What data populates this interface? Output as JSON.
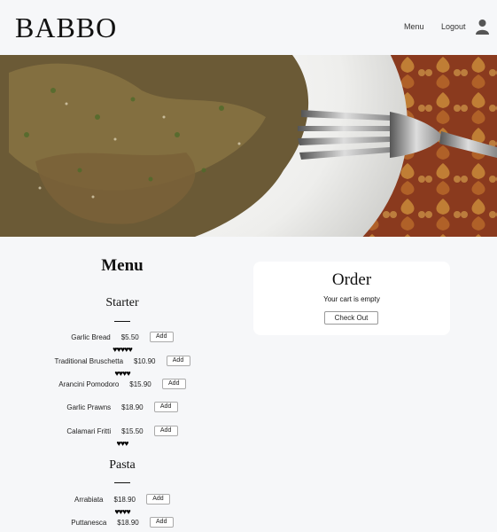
{
  "header": {
    "logo": "BABBO",
    "nav": {
      "menu": "Menu",
      "logout": "Logout"
    },
    "user_icon": "user-icon"
  },
  "hero": {
    "image": "pasta-plate-with-fork"
  },
  "menu": {
    "title": "Menu",
    "add_label": "Add",
    "sections": [
      {
        "title": "Starter",
        "items": [
          {
            "name": "Garlic Bread",
            "price": "$5.50",
            "hearts": "♥♥♥♥♥"
          },
          {
            "name": "Traditional Bruschetta",
            "price": "$10.90",
            "hearts": "♥♥♥♥"
          },
          {
            "name": "Arancini Pomodoro",
            "price": "$15.90",
            "hearts": ""
          },
          {
            "name": "Garlic Prawns",
            "price": "$18.90",
            "hearts": ""
          },
          {
            "name": "Calamari Fritti",
            "price": "$15.50",
            "hearts": "♥♥♥"
          }
        ]
      },
      {
        "title": "Pasta",
        "items": [
          {
            "name": "Arrabiata",
            "price": "$18.90",
            "hearts": "♥♥♥♥"
          },
          {
            "name": "Puttanesca",
            "price": "$18.90",
            "hearts": ""
          }
        ]
      }
    ]
  },
  "order": {
    "title": "Order",
    "empty_text": "Your cart is empty",
    "checkout_label": "Check Out"
  }
}
